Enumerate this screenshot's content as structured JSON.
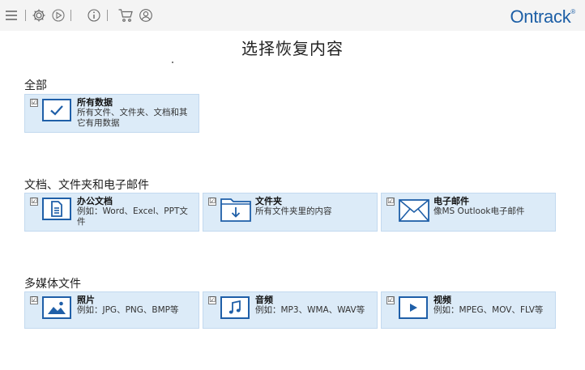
{
  "toolbar": {
    "brand": "Ontrack",
    "brand_mark": "®",
    "icons": [
      "menu-icon",
      "settings-icon",
      "play-icon",
      "info-icon",
      "cart-icon",
      "user-icon"
    ]
  },
  "page": {
    "title": "选择恢复内容"
  },
  "sections": [
    {
      "label": "全部",
      "cards": [
        {
          "title": "所有数据",
          "desc": "所有文件、文件夹、文档和其它有用数据",
          "checked": "☑",
          "icon": "checkmark-icon"
        }
      ]
    },
    {
      "label": "文档、文件夹和电子邮件",
      "cards": [
        {
          "title": "办公文档",
          "desc": "例如：Word、Excel、PPT文件",
          "checked": "☑",
          "icon": "document-icon"
        },
        {
          "title": "文件夹",
          "desc": "所有文件夹里的内容",
          "checked": "☑",
          "icon": "folder-icon"
        },
        {
          "title": "电子邮件",
          "desc": "像MS Outlook电子邮件",
          "checked": "☑",
          "icon": "mail-icon"
        }
      ]
    },
    {
      "label": "多媒体文件",
      "cards": [
        {
          "title": "照片",
          "desc": "例如：JPG、PNG、BMP等",
          "checked": "☑",
          "icon": "photo-icon"
        },
        {
          "title": "音频",
          "desc": "例如：MP3、WMA、WAV等",
          "checked": "☑",
          "icon": "music-icon"
        },
        {
          "title": "视频",
          "desc": "例如：MPEG、MOV、FLV等",
          "checked": "☑",
          "icon": "video-icon"
        }
      ]
    }
  ],
  "colors": {
    "accent": "#1f5fa8",
    "card_bg": "#dcebf8",
    "toolbar_bg": "#f4f4f4"
  }
}
